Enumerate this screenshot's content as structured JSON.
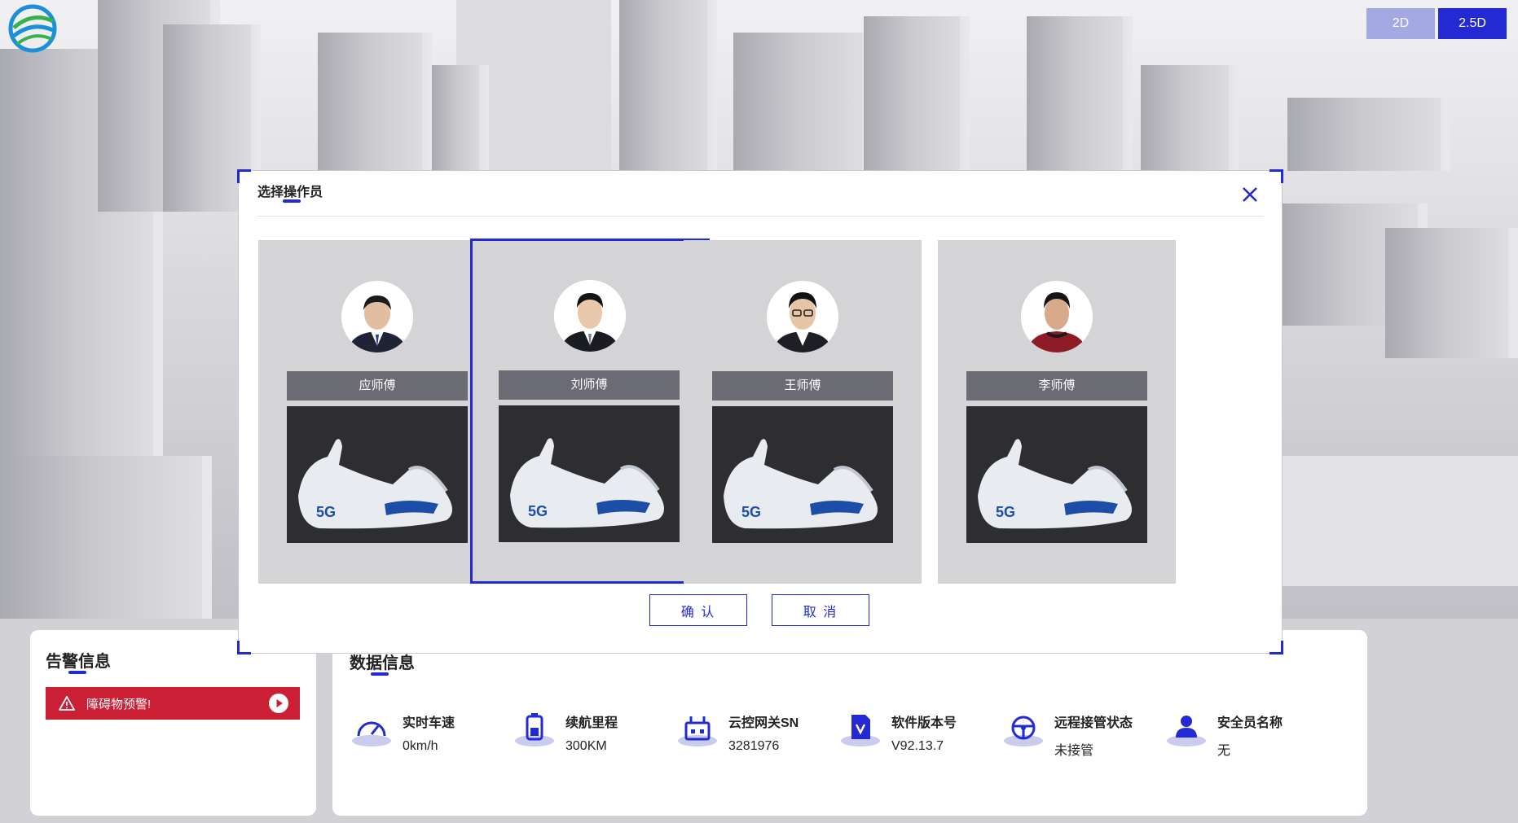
{
  "view_toggle": {
    "options": [
      "2D",
      "2.5D"
    ],
    "active": "2.5D"
  },
  "alarm": {
    "title": "告警信息",
    "items": [
      {
        "text": "障碍物预警!",
        "level_color": "#cb1f35"
      }
    ]
  },
  "data_info": {
    "title": "数据信息",
    "metrics": [
      {
        "label": "实时车速",
        "value": "0km/h",
        "icon": "speedometer-icon"
      },
      {
        "label": "续航里程",
        "value": "300KM",
        "icon": "battery-icon"
      },
      {
        "label": "云控网关SN",
        "value": "3281976",
        "icon": "gateway-icon"
      },
      {
        "label": "软件版本号",
        "value": "V92.13.7",
        "icon": "software-version-icon"
      },
      {
        "label": "远程接管状态",
        "value": "未接管",
        "icon": "steering-wheel-icon"
      },
      {
        "label": "安全员名称",
        "value": "无",
        "icon": "safety-officer-icon"
      }
    ]
  },
  "modal": {
    "title": "选择操作员",
    "operators": [
      {
        "name": "应师傅",
        "selected": false
      },
      {
        "name": "刘师傅",
        "selected": true
      },
      {
        "name": "王师傅",
        "selected": false
      },
      {
        "name": "李师傅",
        "selected": false
      }
    ],
    "confirm_label": "确 认",
    "cancel_label": "取 消"
  },
  "colors": {
    "accent": "#2329d3",
    "alert": "#cb1f35",
    "card_bg": "#d4d4d7",
    "name_bar": "#6b6b73"
  }
}
